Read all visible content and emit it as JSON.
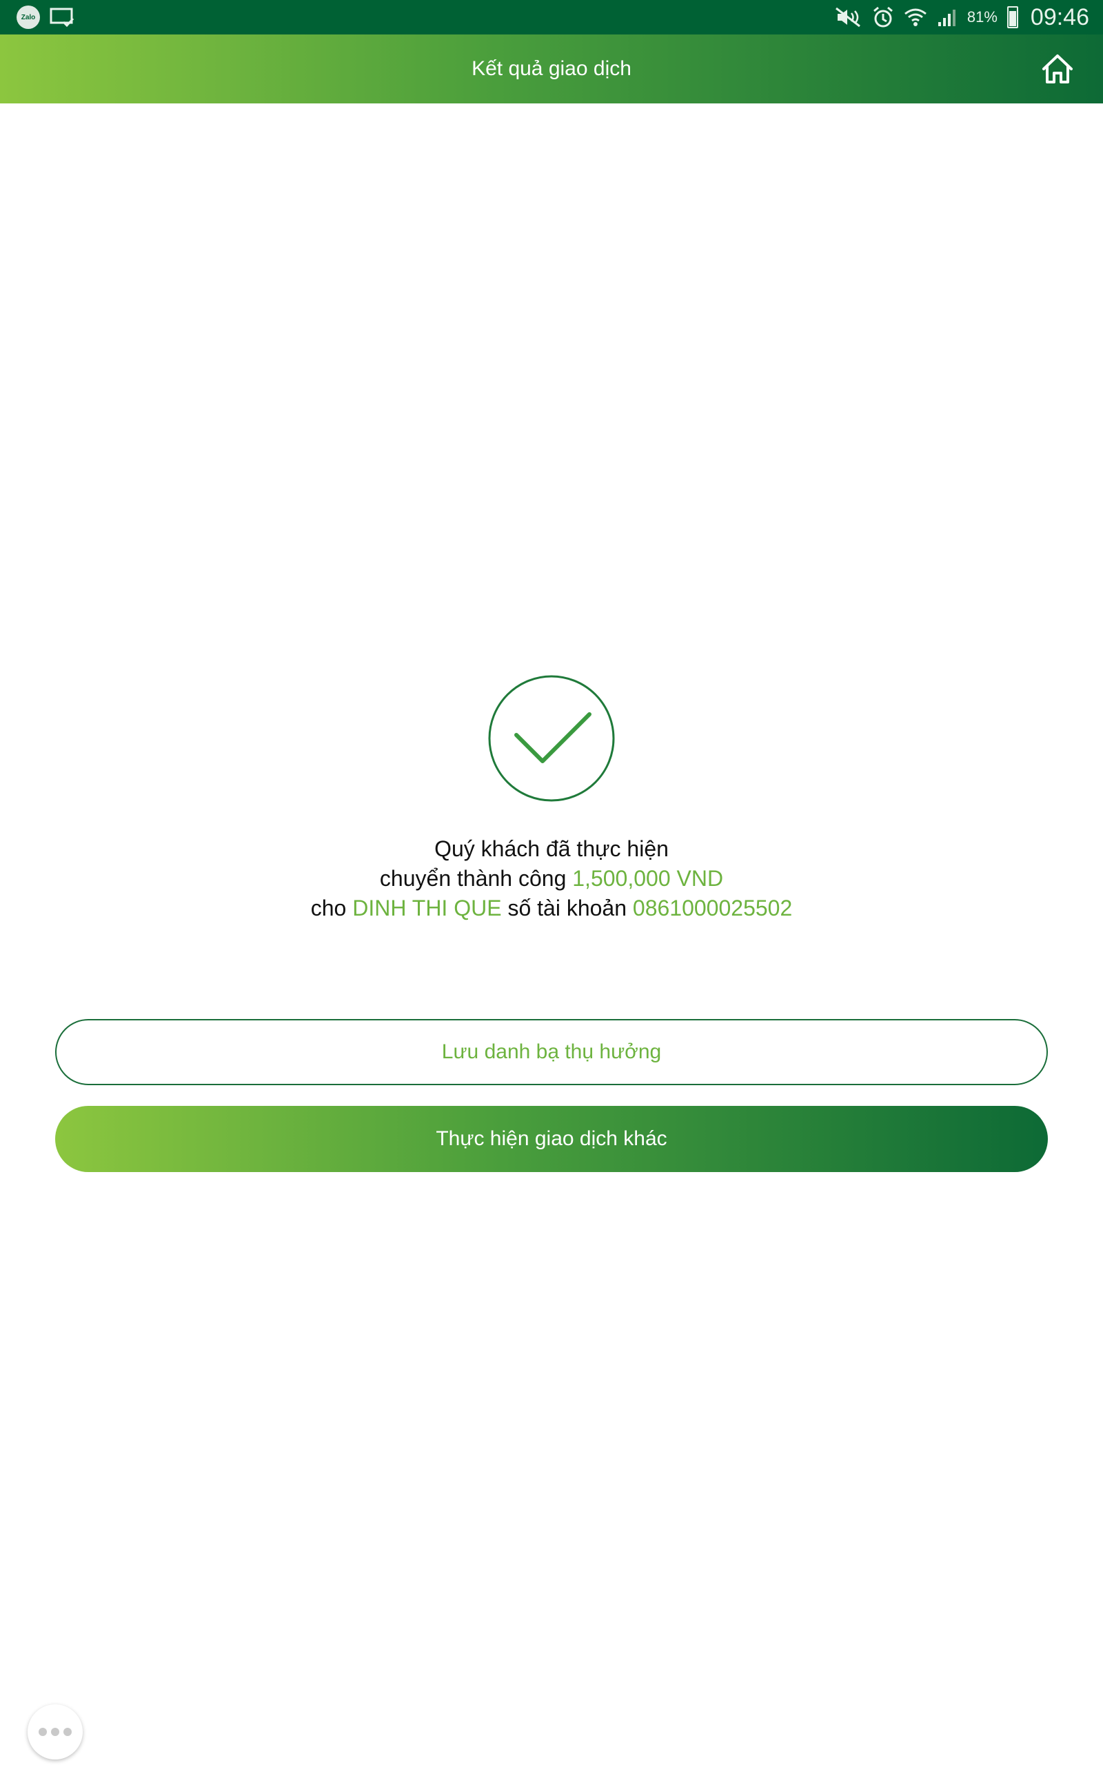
{
  "status_bar": {
    "zalo_label": "Zalo",
    "battery_percent": "81%",
    "time": "09:46",
    "icons": [
      "zalo-icon",
      "screenshot-icon",
      "mute-icon",
      "alarm-icon",
      "wifi-icon",
      "signal-icon",
      "battery-icon"
    ]
  },
  "header": {
    "title": "Kết quả giao dịch",
    "home_icon": "home-icon"
  },
  "result": {
    "icon": "check-circle-icon",
    "line1": "Quý khách đã thực hiện",
    "line2_prefix": "chuyển thành công ",
    "amount": "1,500,000 VND",
    "line3_prefix": "cho ",
    "recipient_name": "DINH THI QUE",
    "line3_middle": " số tài khoản ",
    "account_number": "0861000025502"
  },
  "actions": {
    "save_beneficiary_label": "Lưu danh bạ thụ hưởng",
    "new_transaction_label": "Thực hiện giao dịch khác"
  },
  "colors": {
    "status_bar": "#006134",
    "gradient_start": "#8cc63f",
    "gradient_end": "#0d6a36",
    "highlight": "#6db33f",
    "check_stroke": "#3a9a3f"
  }
}
